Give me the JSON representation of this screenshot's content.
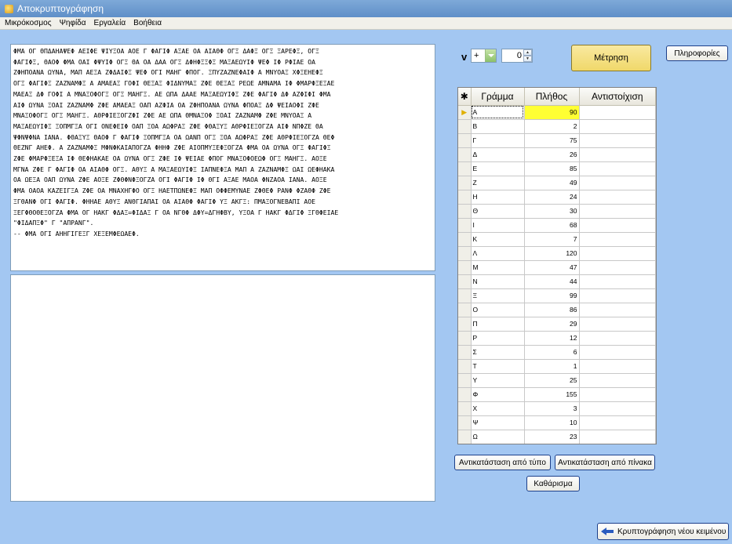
{
  "window": {
    "title": "Αποκρυπτογράφηση"
  },
  "menu": [
    "Μικρόκοσμος",
    "Ψηφίδα",
    "Εργαλεία",
    "Βοήθεια"
  ],
  "cipher_text_lines": [
    "ΦΜΑ ΟΓ ΘΠΔΑΗΑΨΕΦ ΑΕΙΦΕ ΨΙΥΞΟΑ ΑΟΕ Γ ΦΑΓΙΦ ΑΞΑΕ ΟΑ ΑΙΑΘΦ ΟΓΞ ΔΑΦΞ ΟΓΞ ΞΑΡΕΦΞ, ΟΓΞ",
    "ΦΑΓΙΦΞ, ΘΑΟΦ ΦΜΑ ΟΑΙ ΦΨΥΙΦ ΟΓΞ ΘΑ ΟΑ ΔΑΑ ΟΓΞ ΔΦΗΦΞΞΦΞ ΜΑΞΑΕΩΥΙΦ ΨΕΦ ΙΦ ΡΦΙΑΕ ΟΑ",
    "ΖΦΗΠΟΑΝΑ ΩΥΝΑ, ΜΑΠ ΑΕΞΑ ΖΦΔΑΙΦΞ ΨΕΦ ΟΓΙ ΜΑΗΓ ΦΠΟΓ. ΞΠΥΖΑΖΝΕΦΑΙΦ Α ΜΝΥΟΑΞ ΧΦΞΕΗΕΦΞ",
    "ΟΓΞ ΦΑΓΙΦΞ ΖΑΖΝΑΜΦΞ Α ΑΜΑΕΑΞ ΓΟΦΙ ΘΕΞΑΞ ΦΙΔΝΥΜΑΞ ΖΦΕ ΘΕΞΑΞ ΡΕΩΕ ΑΜΝΑΜΑ ΙΦ ΦΜΑΡΦΞΕΞΑΕ",
    "ΜΑΕΑΞ ΔΦ ΓΟΦΙ Α ΜΝΑΞΟΦΟΓΞ ΟΓΞ ΜΑΗΓΞ. ΑΕ ΩΠΑ ΔΑΑΕ ΜΑΞΑΕΩΥΙΦΞ ΖΦΕ ΦΑΓΙΦ ΔΦ ΑΖΦΙΦΙ ΦΜΑ",
    "ΑΙΦ ΩΥΝΑ ΞΟΑΙ ΖΑΖΝΑΜΦ ΖΦΕ ΑΜΑΕΑΞ ΟΑΠ ΑΖΦΙΑ ΟΑ ΖΦΗΠΟΑΝΑ ΩΥΝΑ ΦΠΟΑΞ ΔΦ ΨΕΙΑΟΦΙ ΖΦΕ",
    "ΜΝΑΞΟΦΟΓΞ ΟΓΞ ΜΑΗΓΞ. ΑΘΡΦΙΕΞΟΓΖΦΙ ΖΦΕ ΑΕ ΩΠΑ ΘΜΝΑΞΟΦ ΞΟΑΙ ΖΑΖΝΑΜΦ ΖΦΕ ΜΝΥΟΑΞ Α",
    "ΜΑΞΑΕΩΥΙΦΞ ΞΟΠΜΓΞΑ ΟΓΙ ΟΝΕΦΕΙΦ ΟΑΠ ΞΟΑ ΑΩΦΡΑΞ ΖΦΕ ΦΘΑΞΥΞ ΑΘΡΦΙΕΞΟΓΖΑ ΑΙΦ ΝΠΦΖΕ ΘΑ",
    "ΨΦΝΨΦΝΑ ΙΑΝΑ. ΦΘΑΞΥΞ ΘΑΟΦ Γ ΦΑΓΙΦ ΞΟΠΜΓΞΑ ΟΑ ΩΑΝΠ ΟΓΞ ΞΟΑ ΑΩΦΡΑΞ ΖΦΕ ΑΘΡΦΙΕΞΟΓΖΑ ΘΕΦ",
    "ΘΕΖΝΓ ΑΗΕΦ. Α ΖΑΖΝΑΜΦΞ ΜΦΝΦΚΑΙΑΠΟΓΖΑ ΦΗΗΦ ΖΦΕ ΑΙΟΠΜΥΞΕΦΞΟΓΖΑ ΦΜΑ ΟΑ ΩΥΝΑ ΟΓΞ ΦΑΓΙΦΞ",
    "ΖΦΕ ΦΜΑΡΦΞΕΞΑ ΙΦ ΘΕΦΗΑΚΑΕ ΟΑ ΩΥΝΑ ΟΓΞ ΖΦΕ ΙΦ ΨΕΙΑΕ ΦΠΟΓ ΜΝΑΞΟΦΟΕΩΦ ΟΓΞ ΜΑΗΓΞ. ΑΟΞΕ",
    "ΜΓΝΑ ΖΦΕ Γ ΦΑΓΙΦ ΟΑ ΑΙΑΘΦ ΟΓΞ. ΑΘΥΞ Α ΜΑΞΑΕΩΥΙΦΞ ΙΑΠΝΕΦΞΑ ΜΑΠ Α ΖΑΖΝΑΜΦΞ ΩΑΙ ΩΕΦΗΑΚΑ",
    "ΟΑ ΩΕΞΑ ΟΑΠ ΩΥΝΑ ΖΦΕ ΑΟΞΕ ΖΦΘΦΝΦΞΟΓΖΑ ΟΓΙ ΦΑΓΙΦ ΙΦ ΘΓΙ ΑΞΑΕ ΜΑΟΑ ΦΝΖΑΟΑ ΙΑΝΑ. ΑΟΞΕ",
    "ΦΜΑ ΟΑΟΑ ΚΑΖΕΙΓΞΑ ΖΦΕ ΟΑ ΜΝΑΧΗΓΦΟ ΟΓΞ ΗΑΕΤΠΩΝΕΦΞ ΜΑΠ ΟΦΦΕΜΥΝΑΕ ΖΦΘΕΦ ΡΑΝΦ ΦΖΑΘΦ ΖΦΕ",
    "ΞΓΘΑΝΦ ΟΓΙ ΦΑΓΙΦ. ΦΗΗΑΕ ΑΘΥΞ ΑΝΘΓΙΑΠΑΙ ΟΑ ΑΙΑΘΦ ΦΑΓΙΦ ΥΞ ΑΚΓΞ: ΠΜΑΞΟΓΝΕΒΑΠΙ ΑΟΕ",
    "ΞΕΓΦΘΟΘΕΞΟΓΖΑ ΦΜΑ ΟΓ ΗΑΚΓ ΦΔΑΞ=ΦΙΔΑΞ Γ ΟΑ ΝΓΘΦ ΔΦΥ=ΔΓΗΦΒΥ, ΥΞΟΑ Γ ΗΑΚΓ ΦΔΓΙΦ ΞΓΘΦΕΙΑΕ",
    "\"ΦΙΔΑΠΞΦ\" Γ \"ΑΠΡΑΝΓ\".",
    "-- ΦΜΑ ΟΓΙ ΑΗΗΓΙΓΕΞΓ ΧΕΞΕΜΦΕΩΑΕΦ."
  ],
  "plain_text": "",
  "controls": {
    "variable_label": "v",
    "operator_value": "+",
    "stepper_value": "0",
    "measure_label": "Μέτρηση",
    "info_label": "Πληροφορίες",
    "replace_type_label": "Αντικατάσταση από τύπο",
    "replace_table_label": "Αντικατάσταση από πίνακα",
    "clear_label": "Καθάρισμα",
    "new_text_label": "Κρυπτογράφηση νέου κειμένου"
  },
  "table": {
    "corner": "✱",
    "headers": [
      "Γράμμα",
      "Πλήθος",
      "Αντιστοίχιση"
    ],
    "rows": [
      {
        "letter": "Α",
        "count": "90",
        "map": ""
      },
      {
        "letter": "Β",
        "count": "2",
        "map": ""
      },
      {
        "letter": "Γ",
        "count": "75",
        "map": ""
      },
      {
        "letter": "Δ",
        "count": "26",
        "map": ""
      },
      {
        "letter": "Ε",
        "count": "85",
        "map": ""
      },
      {
        "letter": "Ζ",
        "count": "49",
        "map": ""
      },
      {
        "letter": "Η",
        "count": "24",
        "map": ""
      },
      {
        "letter": "Θ",
        "count": "30",
        "map": ""
      },
      {
        "letter": "Ι",
        "count": "68",
        "map": ""
      },
      {
        "letter": "Κ",
        "count": "7",
        "map": ""
      },
      {
        "letter": "Λ",
        "count": "120",
        "map": ""
      },
      {
        "letter": "Μ",
        "count": "47",
        "map": ""
      },
      {
        "letter": "Ν",
        "count": "44",
        "map": ""
      },
      {
        "letter": "Ξ",
        "count": "99",
        "map": ""
      },
      {
        "letter": "Ο",
        "count": "86",
        "map": ""
      },
      {
        "letter": "Π",
        "count": "29",
        "map": ""
      },
      {
        "letter": "Ρ",
        "count": "12",
        "map": ""
      },
      {
        "letter": "Σ",
        "count": "6",
        "map": ""
      },
      {
        "letter": "Τ",
        "count": "1",
        "map": ""
      },
      {
        "letter": "Υ",
        "count": "25",
        "map": ""
      },
      {
        "letter": "Φ",
        "count": "155",
        "map": ""
      },
      {
        "letter": "Χ",
        "count": "3",
        "map": ""
      },
      {
        "letter": "Ψ",
        "count": "10",
        "map": ""
      },
      {
        "letter": "Ω",
        "count": "23",
        "map": ""
      }
    ]
  },
  "colors": {
    "background": "#a3c7f2",
    "selected_count": "#ffff33",
    "measure_button": "#f0d86a"
  }
}
